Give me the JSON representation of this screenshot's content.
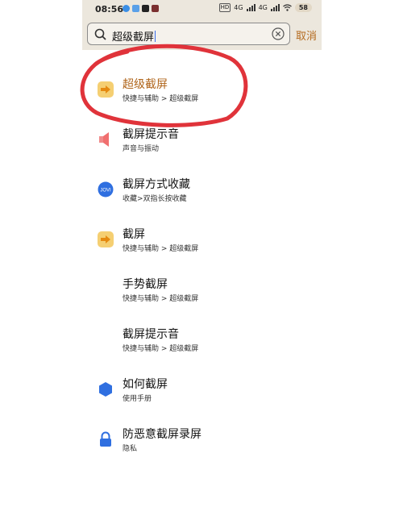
{
  "status": {
    "time": "08:56",
    "battery": "58",
    "net1": "HD",
    "net2": "4G",
    "net3": "4G"
  },
  "search": {
    "query": "超级截屏",
    "cancel_label": "取消"
  },
  "results": [
    {
      "title": "超级截屏",
      "subtitle": "快捷与辅助 > 超级截屏",
      "icon": "arrow-icon"
    },
    {
      "title": "截屏提示音",
      "subtitle": "声音与振动",
      "icon": "speaker-icon"
    },
    {
      "title": "截屏方式收藏",
      "subtitle": "收藏>双指长按收藏",
      "icon": "jovi-icon"
    },
    {
      "title": "截屏",
      "subtitle": "快捷与辅助 > 超级截屏",
      "icon": "arrow-icon"
    },
    {
      "title": "手势截屏",
      "subtitle": "快捷与辅助 > 超级截屏",
      "icon": ""
    },
    {
      "title": "截屏提示音",
      "subtitle": "快捷与辅助 > 超级截屏",
      "icon": ""
    },
    {
      "title": "如何截屏",
      "subtitle": "使用手册",
      "icon": "hexagon-icon"
    },
    {
      "title": "防恶意截屏录屏",
      "subtitle": "隐私",
      "icon": "lock-icon"
    }
  ],
  "colors": {
    "accent": "#b0651b",
    "annotation": "#e0333a",
    "bar_bg": "#ece7dd"
  },
  "icons": {
    "jovi_label": "JOVI"
  }
}
